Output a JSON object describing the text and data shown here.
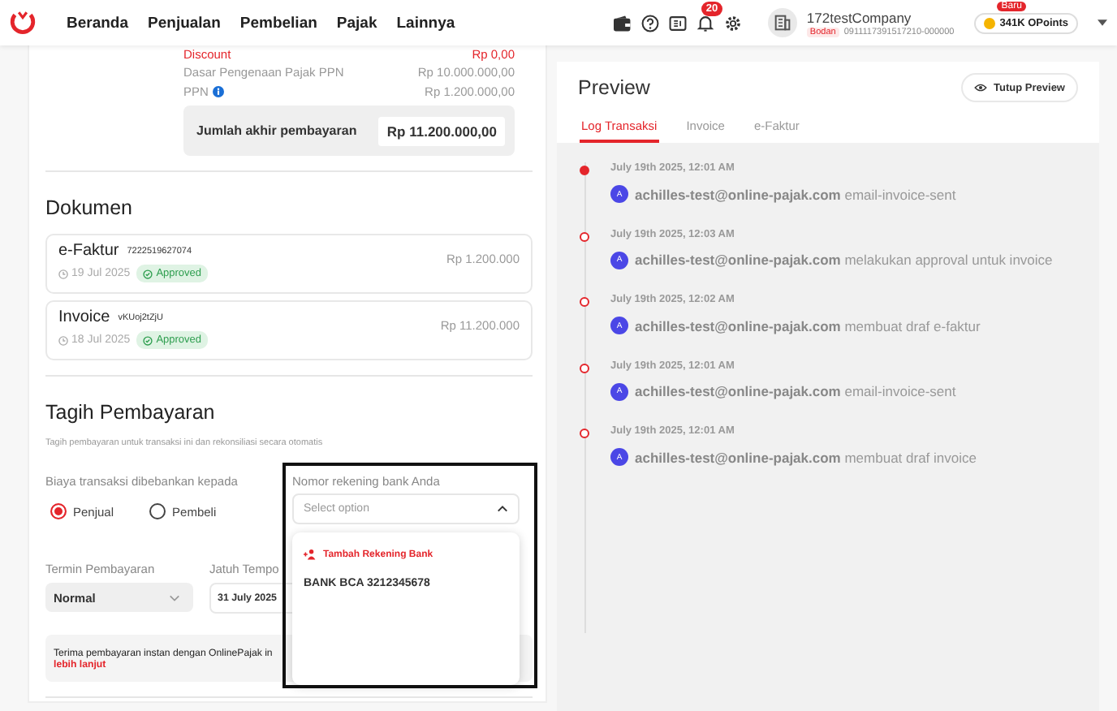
{
  "nav": {
    "menu": [
      {
        "label": "Beranda"
      },
      {
        "label": "Penjualan"
      },
      {
        "label": "Pembelian"
      },
      {
        "label": "Pajak"
      },
      {
        "label": "Lainnya"
      }
    ],
    "notifications": "20",
    "company": {
      "name": "172testCompany",
      "tag": "Bodan",
      "npwp": "0911117391517210-000000"
    },
    "points": {
      "badge": "Baru",
      "label": "341K OPoints"
    }
  },
  "summary": {
    "rows": [
      {
        "label": "Discount",
        "value": "Rp 0,00",
        "kind": "discount"
      },
      {
        "label": "Dasar Pengenaan Pajak PPN",
        "value": "Rp 10.000.000,00",
        "kind": "plain"
      },
      {
        "label": "PPN",
        "value": "Rp 1.200.000,00",
        "kind": "info"
      }
    ],
    "total_label": "Jumlah akhir pembayaran",
    "total_value": "Rp 11.200.000,00"
  },
  "documents": {
    "title": "Dokumen",
    "items": [
      {
        "type": "e-Faktur",
        "number": "7222519627074",
        "date": "19 Jul 2025",
        "status": "Approved",
        "amount": "Rp 1.200.000"
      },
      {
        "type": "Invoice",
        "number": "vKUoj2tZjU",
        "date": "18 Jul 2025",
        "status": "Approved",
        "amount": "Rp 11.200.000"
      }
    ]
  },
  "billing": {
    "title": "Tagih Pembayaran",
    "description": "Tagih pembayaran untuk transaksi ini dan rekonsiliasi secara otomatis",
    "fee_label": "Biaya transaksi dibebankan kepada",
    "fee_options": [
      {
        "label": "Penjual",
        "selected": true
      },
      {
        "label": "Pembeli",
        "selected": false
      }
    ],
    "bank_label": "Nomor rekening bank Anda",
    "bank_placeholder": "Select option",
    "bank_expanded": true,
    "bank_options": [
      {
        "label": "Tambah Rekening Bank",
        "kind": "add"
      },
      {
        "label": "BANK BCA 3212345678",
        "kind": "account"
      }
    ],
    "term_label": "Termin Pembayaran",
    "term_value": "Normal",
    "due_label": "Jatuh Tempo",
    "due_value": "31 July 2025",
    "banner_text": "Terima pembayaran instan dengan OnlinePajak in",
    "banner_link": "lebih lanjut"
  },
  "preview": {
    "title": "Preview",
    "close_button": "Tutup Preview",
    "tabs": [
      {
        "label": "Log Transaksi",
        "selected": true
      },
      {
        "label": "Invoice",
        "selected": false
      },
      {
        "label": "e-Faktur",
        "selected": false
      }
    ],
    "log": [
      {
        "time": "July 19th 2025, 12:01 AM",
        "avatar": "A",
        "user": "achilles-test@online-pajak.com",
        "action": "email-invoice-sent",
        "current": true
      },
      {
        "time": "July 19th 2025, 12:03 AM",
        "avatar": "A",
        "user": "achilles-test@online-pajak.com",
        "action": "melakukan approval untuk invoice",
        "current": false
      },
      {
        "time": "July 19th 2025, 12:02 AM",
        "avatar": "A",
        "user": "achilles-test@online-pajak.com",
        "action": "membuat draf e-faktur",
        "current": false
      },
      {
        "time": "July 19th 2025, 12:01 AM",
        "avatar": "A",
        "user": "achilles-test@online-pajak.com",
        "action": "email-invoice-sent",
        "current": false
      },
      {
        "time": "July 19th 2025, 12:01 AM",
        "avatar": "A",
        "user": "achilles-test@online-pajak.com",
        "action": "membuat draf invoice",
        "current": false
      }
    ]
  }
}
